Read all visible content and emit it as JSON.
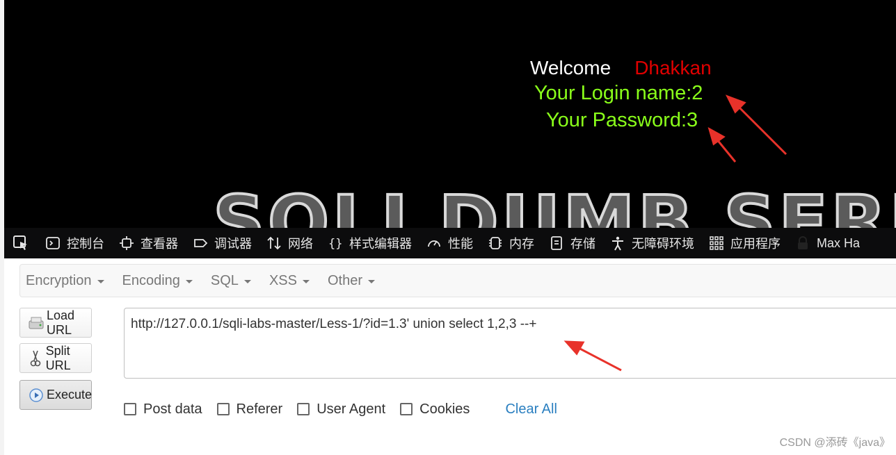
{
  "page": {
    "welcome": "Welcome",
    "user_name": "Dhakkan",
    "login_line": "Your Login name:2",
    "password_line": "Your Password:3",
    "banner": "SQLI DUMB SERIES"
  },
  "devtools": {
    "tabs": [
      {
        "label": "控制台",
        "icon": "console-icon"
      },
      {
        "label": "查看器",
        "icon": "inspector-icon"
      },
      {
        "label": "调试器",
        "icon": "debugger-icon"
      },
      {
        "label": "网络",
        "icon": "network-icon"
      },
      {
        "label": "样式编辑器",
        "icon": "style-editor-icon"
      },
      {
        "label": "性能",
        "icon": "performance-icon"
      },
      {
        "label": "内存",
        "icon": "memory-icon"
      },
      {
        "label": "存储",
        "icon": "storage-icon"
      },
      {
        "label": "无障碍环境",
        "icon": "accessibility-icon"
      },
      {
        "label": "应用程序",
        "icon": "application-icon"
      },
      {
        "label": "Max Ha",
        "icon": "hackbar-icon"
      }
    ]
  },
  "hackbar": {
    "menus": [
      "Encryption",
      "Encoding",
      "SQL",
      "XSS",
      "Other"
    ],
    "load_url": "Load URL",
    "split_url": "Split URL",
    "execute": "Execute",
    "url_value": "http://127.0.0.1/sqli-labs-master/Less-1/?id=1.3' union select 1,2,3  --+",
    "options": [
      "Post data",
      "Referer",
      "User Agent",
      "Cookies"
    ],
    "clear_all": "Clear All"
  },
  "watermark": "CSDN @添砖《java》",
  "colors": {
    "welcome_name": "#e00000",
    "result_text": "#8aff1a",
    "arrow": "#e8322a",
    "link": "#2a7fc0"
  }
}
